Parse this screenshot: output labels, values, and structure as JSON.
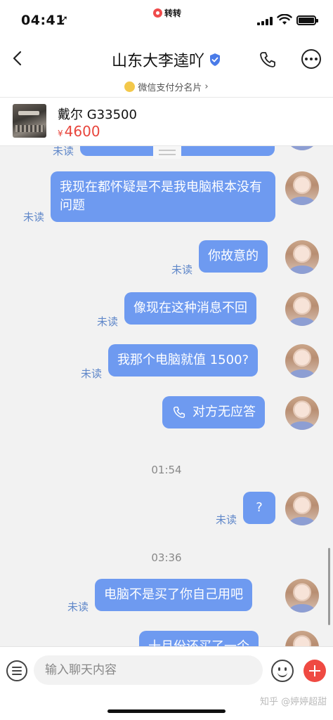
{
  "status_bar": {
    "time": "04:41",
    "app_name": "转转",
    "location_icon": "location-arrow-icon"
  },
  "header": {
    "back_icon": "chevron-left-icon",
    "title": "山东大李逵吖",
    "verified_icon": "verified-shield-icon",
    "call_icon": "phone-icon",
    "more_icon": "more-dots-icon",
    "card_link": "微信支付分名片",
    "card_chevron": "›"
  },
  "product": {
    "name": "戴尔 G33500",
    "currency": "¥",
    "price": "4600"
  },
  "messages": [
    {
      "text": "",
      "status": "未读"
    },
    {
      "text": "我现在都怀疑是不是我电脑根本没有问题",
      "status": "未读"
    },
    {
      "text": "你故意的",
      "status": "未读"
    },
    {
      "text": "像现在这种消息不回",
      "status": "未读"
    },
    {
      "text": "我那个电脑就值 1500?",
      "status": "未读"
    },
    {
      "text": "对方无应答",
      "status": "",
      "icon": "phone-icon"
    },
    {
      "timestamp": "01:54"
    },
    {
      "text": "?",
      "status": "未读"
    },
    {
      "timestamp": "03:36"
    },
    {
      "text": "电脑不是买了你自己用吧",
      "status": "未读"
    },
    {
      "text": "十月份还买了一个",
      "status": ""
    }
  ],
  "input_bar": {
    "placeholder": "输入聊天内容",
    "menu_icon": "menu-icon",
    "emoji_icon": "emoji-icon",
    "plus_icon": "plus-icon"
  },
  "watermark": "知乎 @婷婷超甜",
  "colors": {
    "bubble": "#6e9af0",
    "unread": "#5f87c9",
    "price": "#e8453c",
    "plus": "#ef4a42"
  }
}
